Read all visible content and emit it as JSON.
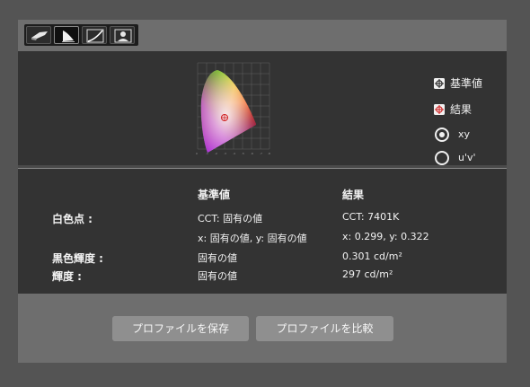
{
  "toolbar": {
    "tabs": [
      {
        "icon": "display-icon"
      },
      {
        "icon": "gamut-icon",
        "active": true
      },
      {
        "icon": "tone-curve-icon"
      },
      {
        "icon": "person-icon"
      }
    ]
  },
  "legend": {
    "reference": {
      "label": "基準値",
      "icon": "reference-marker-icon"
    },
    "result": {
      "label": "結果",
      "icon": "result-marker-icon",
      "color": "#d03030"
    }
  },
  "coordinate_options": {
    "selected": "xy",
    "options": [
      "xy",
      "u'v'"
    ]
  },
  "info": {
    "col_reference": "基準値",
    "col_result": "結果",
    "rows": [
      {
        "label": "白色点 :",
        "reference": "CCT: 固有の値",
        "result": "CCT: 7401K"
      },
      {
        "label": "",
        "reference": "x: 固有の値, y: 固有の値",
        "result": "x: 0.299, y: 0.322"
      },
      {
        "label": "黒色輝度 :",
        "reference": "固有の値",
        "result": "0.301 cd/m²"
      },
      {
        "label": "輝度 :",
        "reference": "固有の値",
        "result": "297 cd/m²"
      }
    ]
  },
  "buttons": {
    "save": "プロファイルを保存",
    "compare": "プロファイルを比較"
  }
}
